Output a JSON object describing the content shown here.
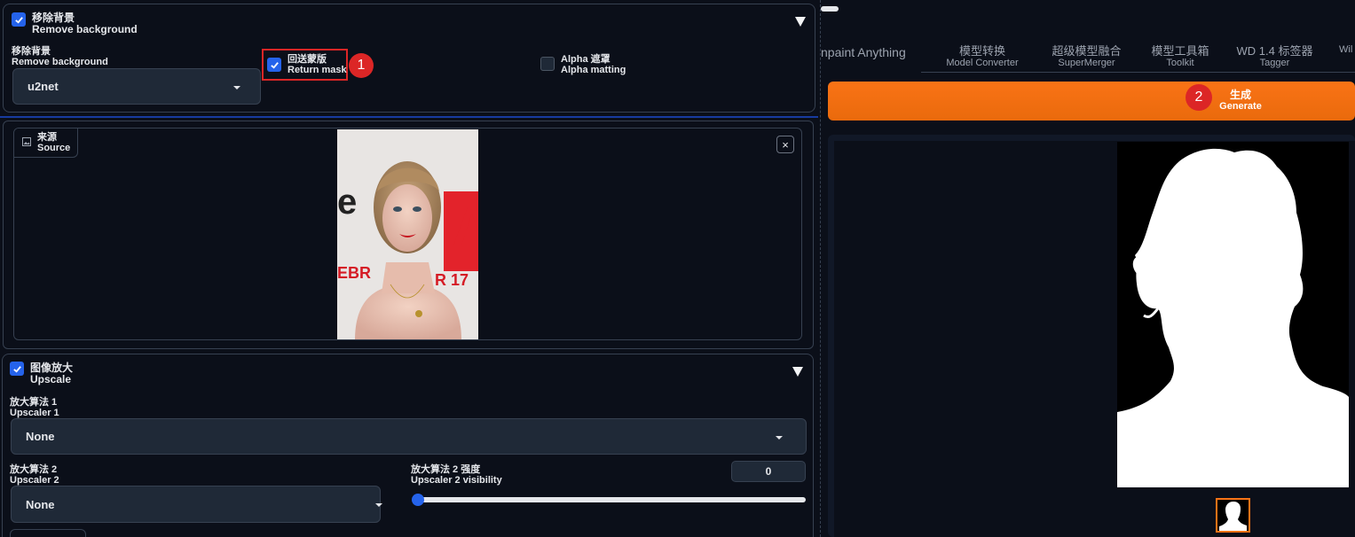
{
  "remove_bg_section": {
    "header_zh": "移除背景",
    "header_en": "Remove background",
    "model_label_zh": "移除背景",
    "model_label_en": "Remove background",
    "model_value": "u2net",
    "return_mask_zh": "回送蒙版",
    "return_mask_en": "Return mask",
    "alpha_zh": "Alpha 遮罩",
    "alpha_en": "Alpha matting",
    "badge": "1"
  },
  "source": {
    "label_zh": "来源",
    "label_en": "Source",
    "close": "×"
  },
  "upscale": {
    "header_zh": "图像放大",
    "header_en": "Upscale",
    "upscaler1_zh": "放大算法 1",
    "upscaler1_en": "Upscaler 1",
    "upscaler1_value": "None",
    "upscaler2_zh": "放大算法 2",
    "upscaler2_en": "Upscaler 2",
    "upscaler2_value": "None",
    "vis_zh": "放大算法 2 强度",
    "vis_en": "Upscaler 2 visibility",
    "vis_value": "0"
  },
  "tabs": [
    {
      "zh": "npaint Anything",
      "en": ""
    },
    {
      "zh": "模型转换",
      "en": "Model Converter"
    },
    {
      "zh": "超级模型融合",
      "en": "SuperMerger"
    },
    {
      "zh": "模型工具箱",
      "en": "Toolkit"
    },
    {
      "zh": "WD 1.4 标签器",
      "en": "Tagger"
    },
    {
      "zh": "",
      "en": "Wil"
    }
  ],
  "generate": {
    "zh": "生成",
    "en": "Generate",
    "badge": "2"
  },
  "colors": {
    "accent": "#2563eb",
    "generate": "#f97316",
    "highlight": "#dc2626"
  }
}
